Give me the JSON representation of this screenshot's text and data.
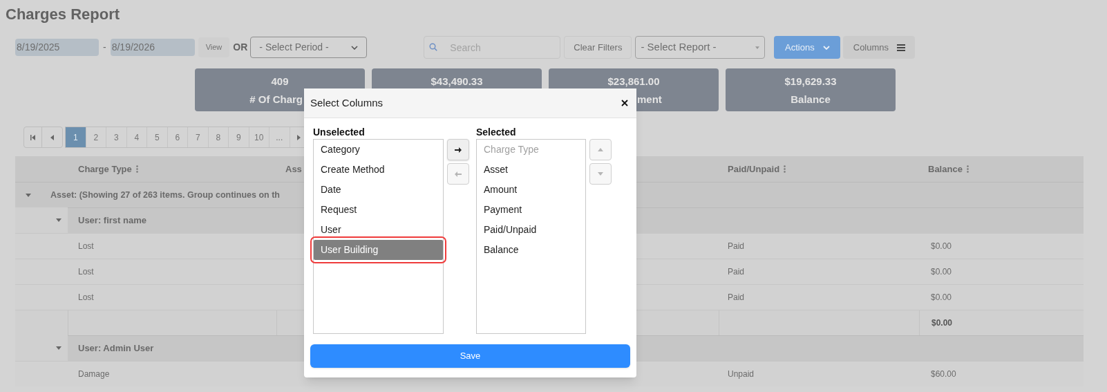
{
  "page": {
    "title": "Charges Report"
  },
  "filters": {
    "start_date": "8/19/2025",
    "separator": "-",
    "end_date": "8/19/2026",
    "view_button": "View",
    "or_label": "OR",
    "period_select": "- Select Period -",
    "search": {
      "placeholder": "Search"
    },
    "clear_button": "Clear Filters",
    "report_select": "- Select Report -",
    "actions_button": "Actions",
    "columns_button": "Columns"
  },
  "summary_cards": [
    {
      "value": "409",
      "label": "# Of Charg"
    },
    {
      "value": "$43,490.33"
    },
    {
      "value": "$23,861.00",
      "label": "ment"
    },
    {
      "value": "$19,629.33",
      "label": "Balance"
    }
  ],
  "pagination": {
    "pages": [
      {
        "label": "1",
        "selected": true
      },
      {
        "label": "2",
        "selected": false
      },
      {
        "label": "3",
        "selected": false
      },
      {
        "label": "4",
        "selected": false
      },
      {
        "label": "5",
        "selected": false
      },
      {
        "label": "6",
        "selected": false
      },
      {
        "label": "7",
        "selected": false
      },
      {
        "label": "8",
        "selected": false
      },
      {
        "label": "9",
        "selected": false
      },
      {
        "label": "10",
        "selected": false
      },
      {
        "label": "...",
        "selected": false
      }
    ]
  },
  "table": {
    "columns": [
      "Charge Type",
      "Ass",
      "Paid/Unpaid",
      "Balance"
    ],
    "groups": [
      {
        "label": "Asset: (Showing 27 of 263 items. Group continues on th",
        "expanded": true,
        "children": [
          {
            "label": "User: first name",
            "expanded": true,
            "rows": [
              {
                "charge_type": "Lost",
                "paid_unpaid": "Paid",
                "balance": "$0.00"
              },
              {
                "charge_type": "Lost",
                "paid_unpaid": "Paid",
                "balance": "$0.00"
              },
              {
                "charge_type": "Lost",
                "paid_unpaid": "Paid",
                "balance": "$0.00"
              }
            ],
            "total": "$0.00"
          },
          {
            "label": "User: Admin User",
            "expanded": true,
            "rows": [
              {
                "charge_type": "Damage",
                "paid_unpaid": "Unpaid",
                "balance": "$60.00"
              }
            ]
          }
        ]
      }
    ]
  },
  "modal": {
    "title": "Select Columns",
    "unselected": {
      "heading": "Unselected",
      "items": [
        {
          "label": "Category",
          "selected": false,
          "highlighted": false
        },
        {
          "label": "Create Method",
          "selected": false,
          "highlighted": false
        },
        {
          "label": "Date",
          "selected": false,
          "highlighted": false
        },
        {
          "label": "Request",
          "selected": false,
          "highlighted": false
        },
        {
          "label": "User",
          "selected": false,
          "highlighted": false
        },
        {
          "label": "User Building",
          "selected": true,
          "highlighted": true
        }
      ]
    },
    "move_right": {
      "disabled": false
    },
    "move_left": {
      "disabled": true
    },
    "selected": {
      "heading": "Selected",
      "items": [
        {
          "label": "Charge Type",
          "disabled": true,
          "selected": false
        },
        {
          "label": "Asset",
          "disabled": false,
          "selected": false
        },
        {
          "label": "Amount",
          "disabled": false,
          "selected": false
        },
        {
          "label": "Payment",
          "disabled": false,
          "selected": false
        },
        {
          "label": "Paid/Unpaid",
          "disabled": false,
          "selected": false
        },
        {
          "label": "Balance",
          "disabled": false,
          "selected": false
        }
      ]
    },
    "move_up": {
      "disabled": true
    },
    "move_down": {
      "disabled": true
    },
    "save_button": "Save"
  }
}
